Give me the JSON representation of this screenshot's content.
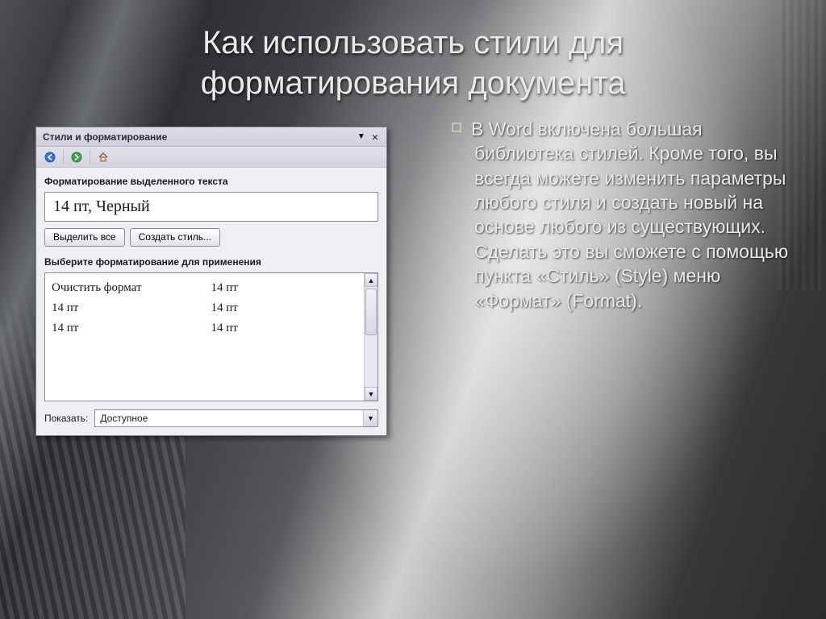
{
  "slide": {
    "title_l1": "Как использовать стили для",
    "title_l2": "форматирования документа",
    "body": "В Word включена большая библиотека стилей. Кроме того, вы всегда можете изменить параметры любого стиля и создать новый на основе любого из существующих. Сделать это вы сможете с помощью пункта «Стиль» (Style) меню «Формат» (Format)."
  },
  "pane": {
    "title": "Стили и форматирование",
    "section_current": "Форматирование выделенного текста",
    "current_format": "14 пт, Черный",
    "btn_select_all": "Выделить все",
    "btn_create_style": "Создать стиль...",
    "section_apply": "Выберите форматирование для применения",
    "list_left": [
      "Очистить формат",
      "14 пт",
      "14 пт"
    ],
    "list_right": [
      "14 пт",
      "14 пт",
      "14 пт"
    ],
    "show_label": "Показать:",
    "show_value": "Доступное"
  }
}
